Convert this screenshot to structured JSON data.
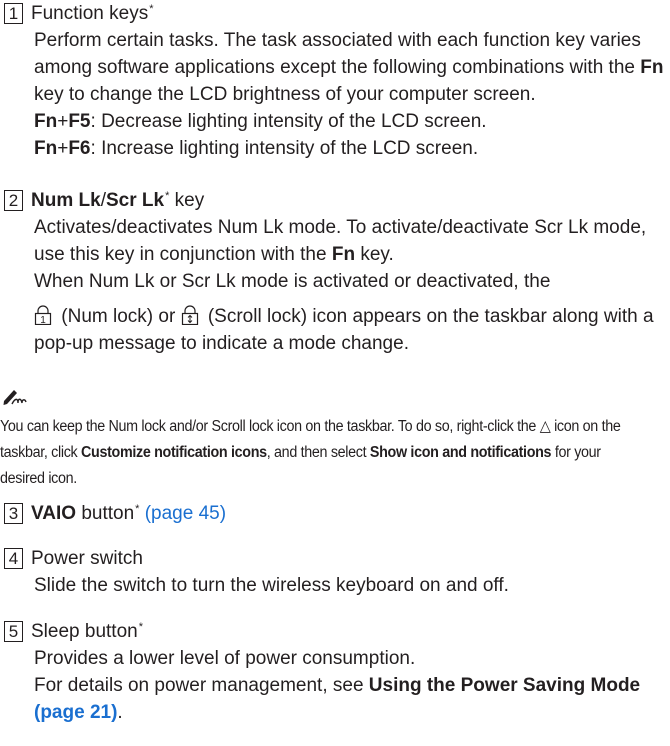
{
  "items": [
    {
      "num": "1",
      "title": "Function keys",
      "star": "*",
      "desc": "Perform certain tasks. The task associated with each function key varies among software applications except the following combinations with the ",
      "desc_bold": "Fn",
      "desc_end": " key to change the LCD brightness of your computer screen.",
      "f5_fn": "Fn",
      "f5_key": "F5",
      "f5_text": ": Decrease lighting intensity of the LCD screen.",
      "f6_fn": "Fn",
      "f6_key": "F6",
      "f6_text": ": Increase lighting intensity of the LCD screen.",
      "plus": "+"
    },
    {
      "num": "2",
      "title_a": "Num Lk",
      "slash": "/",
      "title_b": "Scr Lk",
      "star": "*",
      "title_end": " key",
      "desc1": "Activates/deactivates Num Lk mode. To activate/deactivate Scr Lk mode, use this key in conjunction with the ",
      "desc1_bold": "Fn",
      "desc1_end": " key.",
      "desc2": "When Num Lk or Scr Lk mode is activated or deactivated, the",
      "icon1_label": " (Num lock) or ",
      "icon2_label": " (Scroll lock) icon appears on the taskbar along with a pop-up message to indicate a mode change."
    },
    {
      "num": "3",
      "title": "VAIO",
      "title_end": " button",
      "star": "*",
      "link": "(page 45)"
    },
    {
      "num": "4",
      "title": "Power switch",
      "desc": "Slide the switch to turn the wireless keyboard on and off."
    },
    {
      "num": "5",
      "title": "Sleep button",
      "star": "*",
      "desc1": "Provides a lower level of power consumption.",
      "desc2": "For details on power management, see ",
      "desc2_bold": "Using the Power Saving Mode",
      "desc2_link": "(page 21)",
      "desc2_end": "."
    }
  ],
  "note": {
    "line1": "You can keep the Num lock and/or Scroll lock icon on the taskbar. To do so, right-click the ",
    "triangle": "△",
    "line1b": " icon on the taskbar, click ",
    "bold1": "Customize notification icons",
    "line1c": ", and then select ",
    "bold2": "Show icon and notifications",
    "line1d": " for your desired icon."
  }
}
